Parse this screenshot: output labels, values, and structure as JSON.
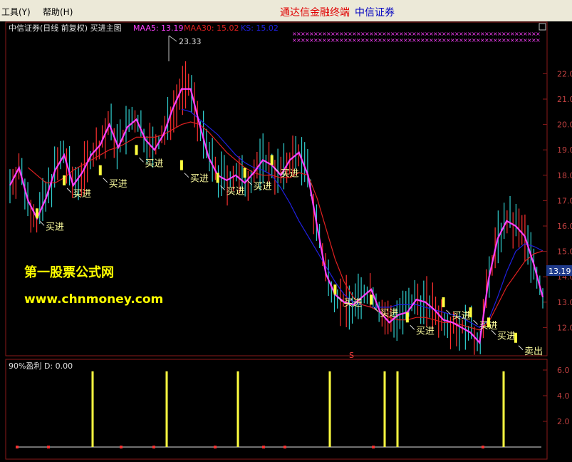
{
  "menubar": {
    "items": [
      {
        "label": "工具(Y)"
      },
      {
        "label": "帮助(H)"
      }
    ],
    "brand": "通达信金融终端",
    "brand_color": "#e00000",
    "stock": "中信证券",
    "stock_color": "#0000c0"
  },
  "main_panel": {
    "title": "中信证券(日线 前复权) 买进主图",
    "legend": [
      {
        "label": "MAA5: 13.19",
        "color": "#ff40ff"
      },
      {
        "label": "MAA30: 15.02",
        "color": "#e02020"
      },
      {
        "label": "KS: 15.02",
        "color": "#2020e0"
      }
    ],
    "peak_label": "23.33",
    "current_price": "13.19",
    "watermark_line1": "第一股票公式网",
    "watermark_line2": "www.chnmoney.com",
    "period_marker": "S"
  },
  "sub_panel": {
    "title": "90%盈利  D: 0.00"
  },
  "chart_data": [
    {
      "type": "line",
      "title": "中信证券(日线 前复权) 买进主图",
      "ylim": [
        11.0,
        23.5
      ],
      "y_ticks": [
        "22.0",
        "21.0",
        "20.0",
        "19.0",
        "18.0",
        "17.0",
        "16.0",
        "15.0",
        "14.0",
        "13.0",
        "12.0"
      ],
      "candle_highs_lows": "daily price bars (approx.)",
      "series": [
        {
          "name": "MAA5",
          "color": "#ff40ff",
          "values": [
            17.6,
            18.3,
            17.0,
            16.3,
            17.1,
            18.2,
            18.8,
            17.6,
            18.1,
            18.8,
            19.2,
            20.0,
            19.1,
            19.9,
            20.2,
            19.4,
            19.0,
            19.6,
            20.6,
            21.4,
            21.4,
            20.0,
            18.7,
            18.0,
            17.8,
            18.0,
            17.7,
            18.1,
            18.6,
            18.4,
            18.0,
            18.6,
            18.9,
            18.0,
            16.0,
            14.1,
            13.3,
            13.0,
            12.9,
            13.2,
            13.5,
            12.6,
            12.2,
            12.5,
            12.6,
            13.1,
            13.0,
            12.7,
            12.3,
            12.2,
            12.0,
            11.8,
            11.4,
            13.9,
            15.5,
            16.2,
            16.0,
            15.6,
            14.5,
            13.2
          ]
        },
        {
          "name": "MAA30",
          "color": "#e02020",
          "values": [
            null,
            null,
            18.3,
            18.0,
            17.7,
            17.7,
            17.9,
            18.2,
            18.4,
            18.6,
            18.8,
            19.0,
            19.1,
            19.3,
            19.5,
            19.5,
            19.5,
            19.6,
            19.8,
            20.0,
            20.1,
            20.0,
            19.7,
            19.3,
            18.9,
            18.6,
            18.3,
            18.1,
            18.0,
            18.0,
            17.9,
            17.9,
            18.1,
            18.0,
            17.1,
            15.9,
            14.7,
            13.8,
            13.2,
            12.9,
            12.8,
            12.6,
            12.4,
            12.3,
            12.3,
            12.4,
            12.4,
            12.3,
            12.2,
            12.2,
            12.1,
            12.0,
            11.9,
            12.2,
            12.9,
            13.6,
            14.1,
            14.6,
            14.9,
            15.02
          ]
        },
        {
          "name": "KS",
          "color": "#2020e0",
          "values": [
            null,
            null,
            null,
            null,
            null,
            null,
            null,
            null,
            null,
            null,
            null,
            null,
            null,
            null,
            null,
            null,
            null,
            null,
            null,
            20.6,
            20.5,
            20.2,
            19.9,
            19.6,
            19.2,
            18.8,
            18.5,
            18.3,
            18.2,
            18.0,
            17.5,
            16.9,
            16.2,
            15.6,
            15.0,
            14.4,
            13.8,
            13.3,
            13.0,
            12.9,
            12.8,
            12.8,
            12.8,
            12.9,
            12.9,
            12.9,
            12.8,
            12.7,
            12.6,
            12.5,
            12.4,
            12.2,
            12.0,
            12.3,
            13.2,
            14.2,
            15.0,
            15.3,
            15.2,
            15.02
          ]
        }
      ],
      "annotations": [
        {
          "text": "买进",
          "x": 3,
          "y": 16.3
        },
        {
          "text": "买进",
          "x": 6,
          "y": 17.6
        },
        {
          "text": "买进",
          "x": 10,
          "y": 18.0
        },
        {
          "text": "买进",
          "x": 14,
          "y": 18.8
        },
        {
          "text": "买进",
          "x": 19,
          "y": 18.2
        },
        {
          "text": "买进",
          "x": 23,
          "y": 17.7
        },
        {
          "text": "买进",
          "x": 26,
          "y": 17.9
        },
        {
          "text": "买进",
          "x": 29,
          "y": 18.4
        },
        {
          "text": "买进",
          "x": 36,
          "y": 13.3
        },
        {
          "text": "买进",
          "x": 40,
          "y": 12.9
        },
        {
          "text": "买进",
          "x": 44,
          "y": 12.2
        },
        {
          "text": "买进",
          "x": 48,
          "y": 12.8
        },
        {
          "text": "买进",
          "x": 51,
          "y": 12.4
        },
        {
          "text": "买进",
          "x": 53,
          "y": 12.0
        },
        {
          "text": "卖出",
          "x": 56,
          "y": 11.4
        }
      ]
    },
    {
      "type": "bar",
      "title": "90%盈利  D: 0.00",
      "ylim": [
        0,
        6.5
      ],
      "y_ticks": [
        "6.0",
        "4.0",
        "2.0"
      ],
      "bars": [
        {
          "x": 130,
          "value": 5.9
        },
        {
          "x": 234,
          "value": 5.9
        },
        {
          "x": 334,
          "value": 5.9
        },
        {
          "x": 463,
          "value": 5.9
        },
        {
          "x": 540,
          "value": 5.9
        },
        {
          "x": 558,
          "value": 5.9
        },
        {
          "x": 707,
          "value": 5.9
        }
      ]
    }
  ]
}
